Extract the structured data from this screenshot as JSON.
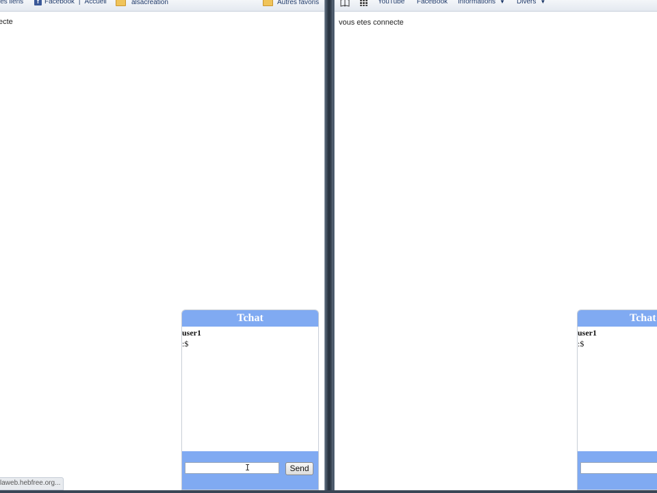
{
  "left_window": {
    "bookmarks": {
      "item1": "les liens",
      "item2_a": "Facebook",
      "item2_sep": "|",
      "item2_b": "Accueil",
      "item3": "alsacreation",
      "other": "Autres favoris"
    },
    "page_text": "ecte",
    "chat": {
      "title": "Tchat",
      "user": "user1",
      "line": ":$",
      "send_label": "Send",
      "input_value": ""
    },
    "status_url": "laweb.hebfree.org..."
  },
  "right_window": {
    "bookmarks": {
      "youtube": "YouTube",
      "facebook": "FaceBook",
      "informations": "Informations",
      "divers": "Divers",
      "caret": "▼"
    },
    "page_text": "vous etes connecte",
    "chat": {
      "title": "Tchat",
      "user": "user1",
      "line": ":$",
      "input_value": ""
    }
  },
  "icons": {
    "facebook": "facebook-icon",
    "folder": "folder-icon",
    "book": "book-icon",
    "grid": "apps-grid-icon",
    "text_cursor": "text-cursor-icon"
  },
  "colors": {
    "chat_header": "#80aaf2",
    "facebook_blue": "#3b5998",
    "folder": "#f0c45a"
  }
}
